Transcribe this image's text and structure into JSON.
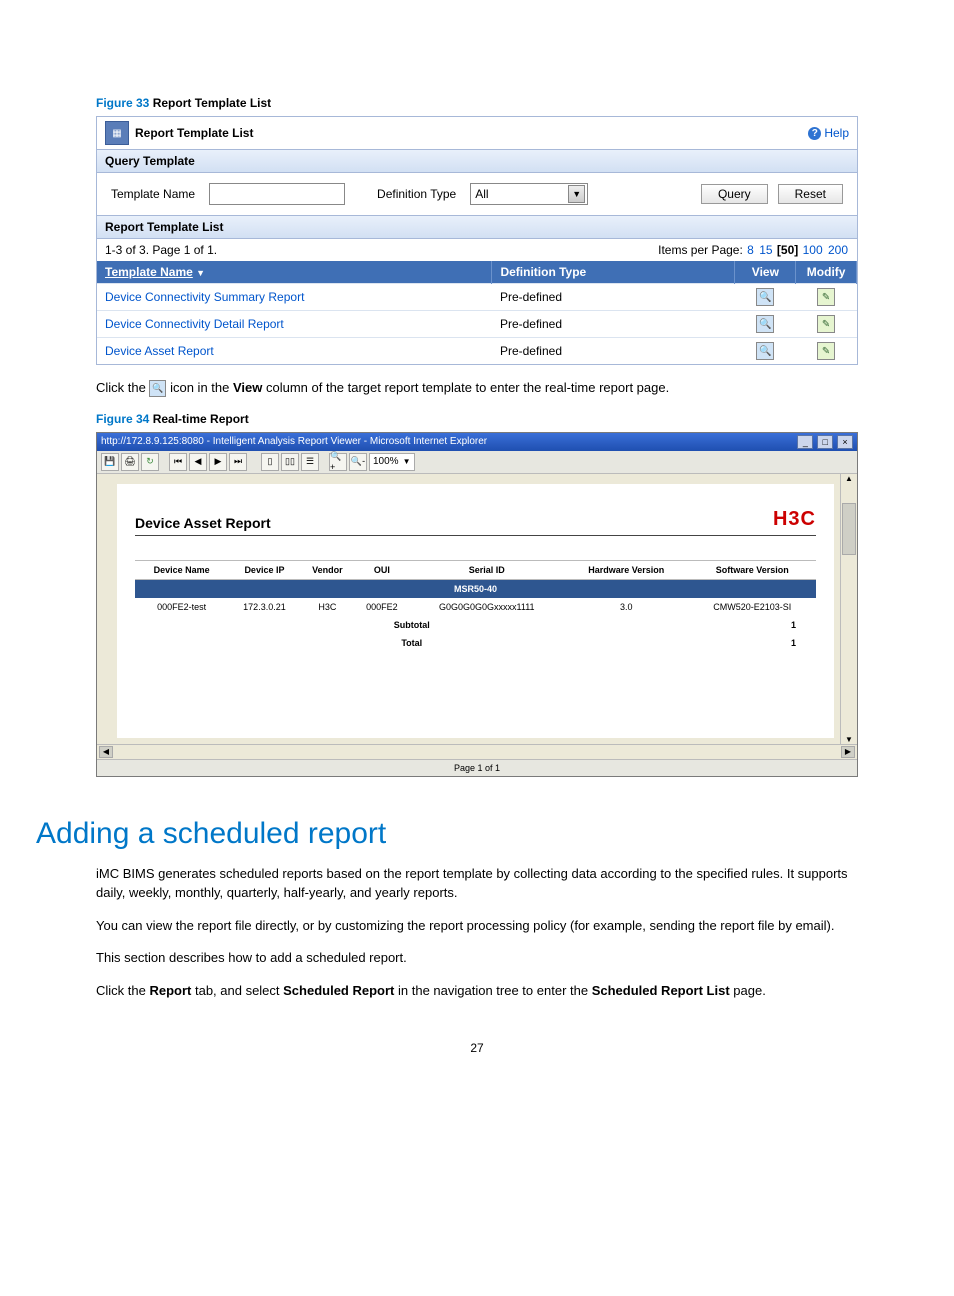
{
  "fig33": {
    "num": "Figure 33",
    "title": "Report Template List"
  },
  "panel": {
    "title": "Report Template List",
    "help": "Help",
    "query_header": "Query Template",
    "tn_label": "Template Name",
    "dt_label": "Definition Type",
    "dt_value": "All",
    "btn_query": "Query",
    "btn_reset": "Reset",
    "list_header": "Report Template List",
    "pager_left": "1-3 of 3. Page 1 of 1.",
    "ipp_label": "Items per Page:",
    "ipp": [
      "8",
      "15",
      "[50]",
      "100",
      "200"
    ],
    "col_name": "Template Name",
    "col_def": "Definition Type",
    "col_view": "View",
    "col_mod": "Modify",
    "rows": [
      {
        "name": "Device Connectivity Summary Report",
        "def": "Pre-defined"
      },
      {
        "name": "Device Connectivity Detail Report",
        "def": "Pre-defined"
      },
      {
        "name": "Device Asset Report",
        "def": "Pre-defined"
      }
    ]
  },
  "instr1_a": "Click the ",
  "instr1_b": " icon in the ",
  "instr1_view": "View",
  "instr1_c": " column of the target report template to enter the real-time report page.",
  "fig34": {
    "num": "Figure 34",
    "title": "Real-time Report"
  },
  "ie": {
    "title": "http://172.8.9.125:8080 - Intelligent Analysis Report Viewer - Microsoft Internet Explorer",
    "zoom": "100%",
    "page_footer": "Page 1 of 1"
  },
  "report": {
    "title": "Device Asset Report",
    "logo": "H3C",
    "cols": [
      "Device Name",
      "Device IP",
      "Vendor",
      "OUI",
      "Serial ID",
      "Hardware Version",
      "Software Version"
    ],
    "group": "MSR50-40",
    "row": [
      "000FE2-test",
      "172.3.0.21",
      "H3C",
      "000FE2",
      "G0G0G0G0Gxxxxx1111",
      "3.0",
      "CMW520-E2103-SI"
    ],
    "subtotal_label": "Subtotal",
    "subtotal_val": "1",
    "total_label": "Total",
    "total_val": "1"
  },
  "h1": "Adding a scheduled report",
  "p1": "iMC BIMS generates scheduled reports based on the report template by collecting data according to the specified rules. It supports daily, weekly, monthly, quarterly, half-yearly, and yearly reports.",
  "p2": "You can view the report file directly, or by customizing the report processing policy (for example, sending the report file by email).",
  "p3": "This section describes how to add a scheduled report.",
  "p4_a": "Click the ",
  "p4_report": "Report",
  "p4_b": " tab, and select ",
  "p4_sched": "Scheduled Report",
  "p4_c": " in the navigation tree to enter the ",
  "p4_list": "Scheduled Report List",
  "p4_d": " page.",
  "page_num": "27"
}
